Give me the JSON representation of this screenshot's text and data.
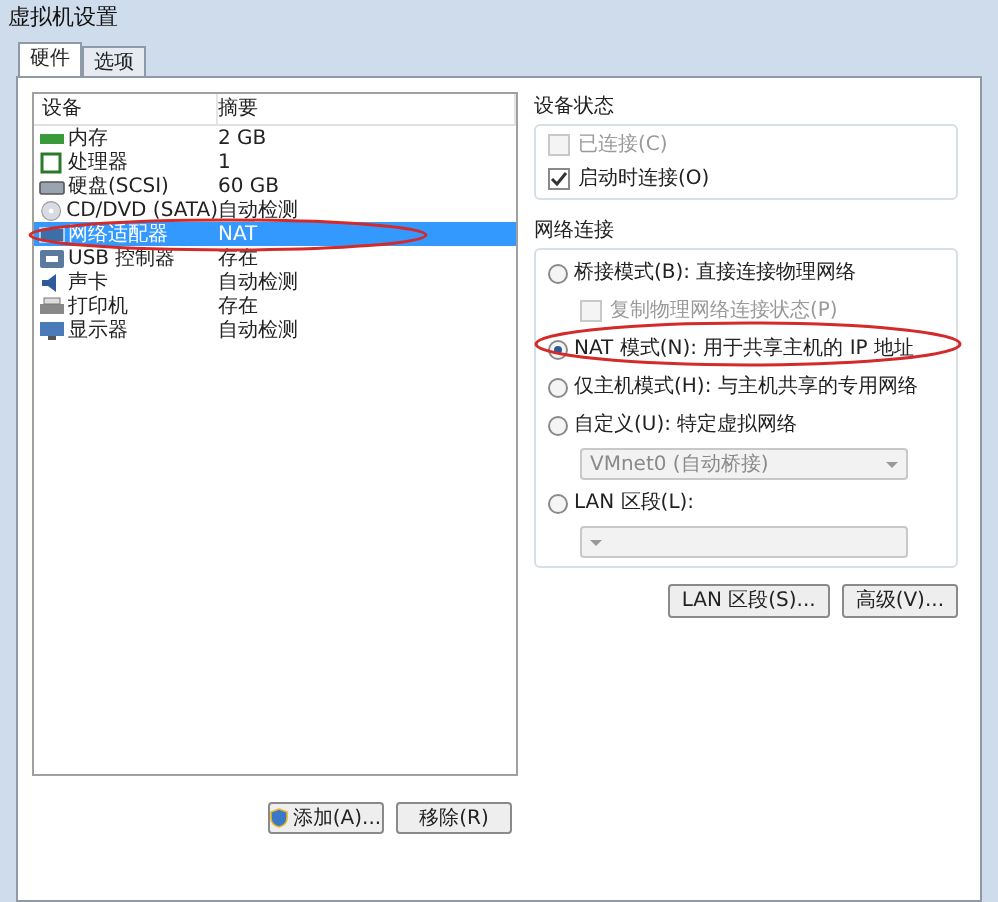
{
  "window": {
    "title": "虚拟机设置"
  },
  "tabs": [
    {
      "label": "硬件",
      "selected": true
    },
    {
      "label": "选项",
      "selected": false
    }
  ],
  "device_list": {
    "columns": [
      "设备",
      "摘要"
    ],
    "rows": [
      {
        "kind": "memory",
        "device": "内存",
        "summary": "2 GB",
        "selected": false
      },
      {
        "kind": "cpu",
        "device": "处理器",
        "summary": "1",
        "selected": false
      },
      {
        "kind": "disk",
        "device": "硬盘(SCSI)",
        "summary": "60 GB",
        "selected": false
      },
      {
        "kind": "cd",
        "device": "CD/DVD (SATA)",
        "summary": "自动检测",
        "selected": false
      },
      {
        "kind": "network",
        "device": "网络适配器",
        "summary": "NAT",
        "selected": true
      },
      {
        "kind": "usb",
        "device": "USB 控制器",
        "summary": "存在",
        "selected": false
      },
      {
        "kind": "sound",
        "device": "声卡",
        "summary": "自动检测",
        "selected": false
      },
      {
        "kind": "printer",
        "device": "打印机",
        "summary": "存在",
        "selected": false
      },
      {
        "kind": "display",
        "device": "显示器",
        "summary": "自动检测",
        "selected": false
      }
    ]
  },
  "device_status": {
    "title": "设备状态",
    "options": [
      {
        "label": "已连接(C)",
        "checked": false,
        "disabled": true
      },
      {
        "label": "启动时连接(O)",
        "checked": true,
        "disabled": false
      }
    ]
  },
  "network": {
    "title": "网络连接",
    "options": [
      {
        "kind": "radio",
        "label": "桥接模式(B): 直接连接物理网络",
        "selected": false
      },
      {
        "kind": "subcheck",
        "label": "复制物理网络连接状态(P)",
        "checked": false,
        "disabled": true
      },
      {
        "kind": "radio",
        "label": "NAT 模式(N): 用于共享主机的 IP 地址",
        "selected": true,
        "circled": true
      },
      {
        "kind": "radio",
        "label": "仅主机模式(H): 与主机共享的专用网络",
        "selected": false
      },
      {
        "kind": "radio",
        "label": "自定义(U): 特定虚拟网络",
        "selected": false
      },
      {
        "kind": "dropdown",
        "value": "VMnet0 (自动桥接)",
        "disabled": true
      },
      {
        "kind": "radio",
        "label": "LAN 区段(L):",
        "selected": false
      },
      {
        "kind": "dropdown",
        "disabled": true
      }
    ]
  },
  "right_buttons": [
    "LAN 区段(S)...",
    "高级(V)..."
  ],
  "bottom_buttons": [
    {
      "label": "添加(A)...",
      "shield": true
    },
    {
      "label": "移除(R)",
      "shield": false
    }
  ]
}
